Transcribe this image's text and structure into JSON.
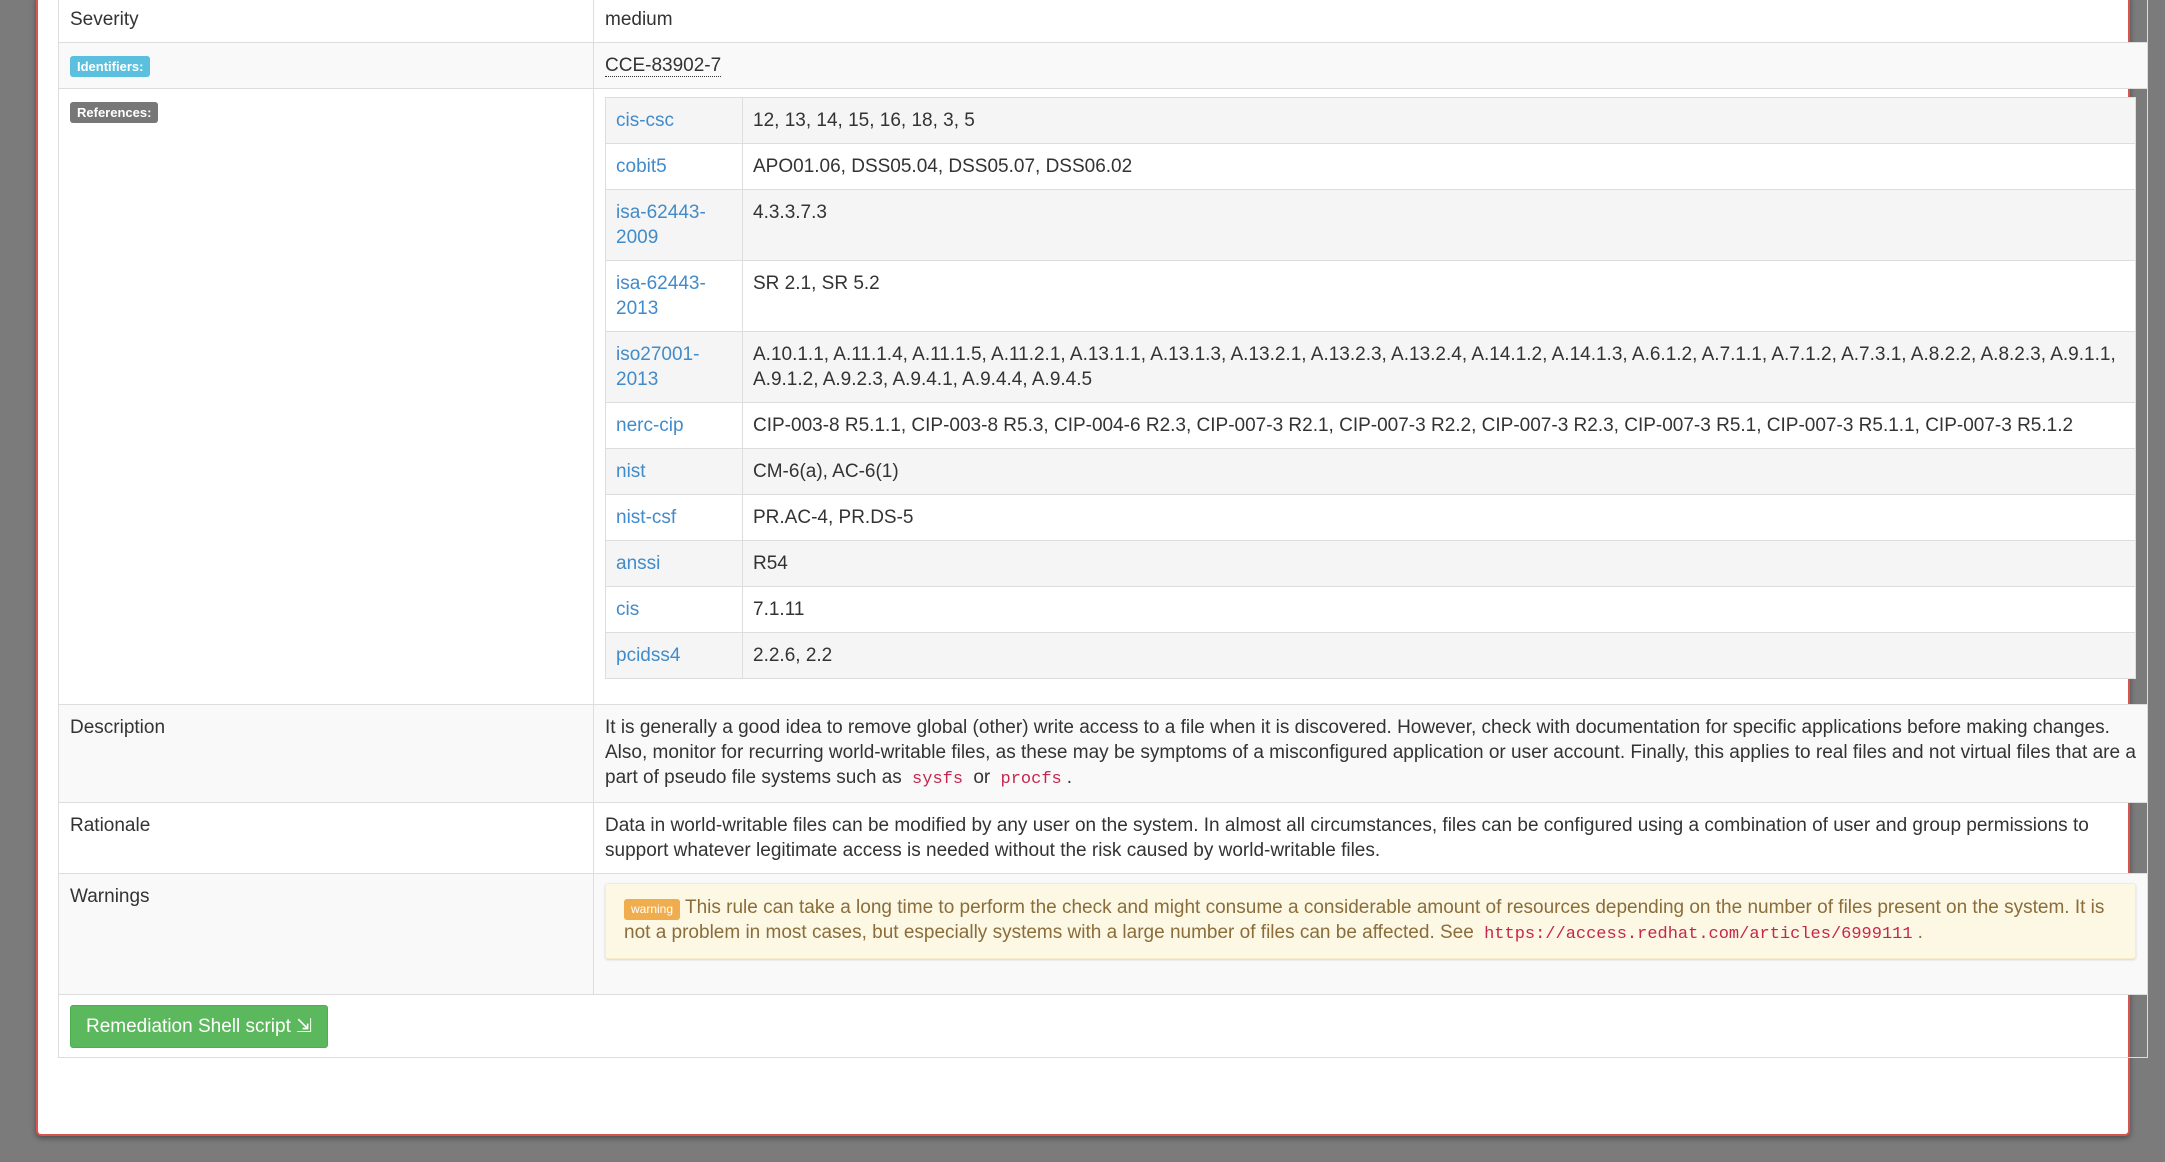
{
  "rows": {
    "severity": {
      "label": "Severity",
      "value": "medium"
    },
    "identifiers": {
      "badge": "Identifiers:",
      "value": "CCE-83902-7"
    },
    "references": {
      "badge": "References:",
      "items": [
        {
          "name": "cis-csc",
          "value": "12, 13, 14, 15, 16, 18, 3, 5"
        },
        {
          "name": "cobit5",
          "value": "APO01.06, DSS05.04, DSS05.07, DSS06.02"
        },
        {
          "name": "isa-62443-2009",
          "value": "4.3.3.7.3"
        },
        {
          "name": "isa-62443-2013",
          "value": "SR 2.1, SR 5.2"
        },
        {
          "name": "iso27001-2013",
          "value": "A.10.1.1, A.11.1.4, A.11.1.5, A.11.2.1, A.13.1.1, A.13.1.3, A.13.2.1, A.13.2.3, A.13.2.4, A.14.1.2, A.14.1.3, A.6.1.2, A.7.1.1, A.7.1.2, A.7.3.1, A.8.2.2, A.8.2.3, A.9.1.1, A.9.1.2, A.9.2.3, A.9.4.1, A.9.4.4, A.9.4.5"
        },
        {
          "name": "nerc-cip",
          "value": "CIP-003-8 R5.1.1, CIP-003-8 R5.3, CIP-004-6 R2.3, CIP-007-3 R2.1, CIP-007-3 R2.2, CIP-007-3 R2.3, CIP-007-3 R5.1, CIP-007-3 R5.1.1, CIP-007-3 R5.1.2"
        },
        {
          "name": "nist",
          "value": "CM-6(a), AC-6(1)"
        },
        {
          "name": "nist-csf",
          "value": "PR.AC-4, PR.DS-5"
        },
        {
          "name": "anssi",
          "value": "R54"
        },
        {
          "name": "cis",
          "value": "7.1.11"
        },
        {
          "name": "pcidss4",
          "value": "2.2.6, 2.2"
        }
      ]
    },
    "description": {
      "label": "Description",
      "text": "It is generally a good idea to remove global (other) write access to a file when it is discovered. However, check with documentation for specific applications before making changes. Also, monitor for recurring world-writable files, as these may be symptoms of a misconfigured application or user account. Finally, this applies to real files and not virtual files that are a part of pseudo file systems such as",
      "code1": "sysfs",
      "or": "or",
      "code2": "procfs",
      "end": "."
    },
    "rationale": {
      "label": "Rationale",
      "text": "Data in world-writable files can be modified by any user on the system. In almost all circumstances, files can be configured using a combination of user and group permissions to support whatever legitimate access is needed without the risk caused by world-writable files."
    },
    "warnings": {
      "label": "Warnings",
      "badge": "warning",
      "text": "This rule can take a long time to perform the check and might consume a considerable amount of resources depending on the number of files present on the system. It is not a problem in most cases, but especially systems with a large number of files can be affected. See",
      "url": "https://access.redhat.com/articles/6999111",
      "end": "."
    }
  },
  "remediation_button": "Remediation Shell script ⇲",
  "colors": {
    "accent": "#428bca",
    "success": "#5cb85c",
    "warning": "#f0ad4e",
    "danger_border": "#d9534f"
  }
}
